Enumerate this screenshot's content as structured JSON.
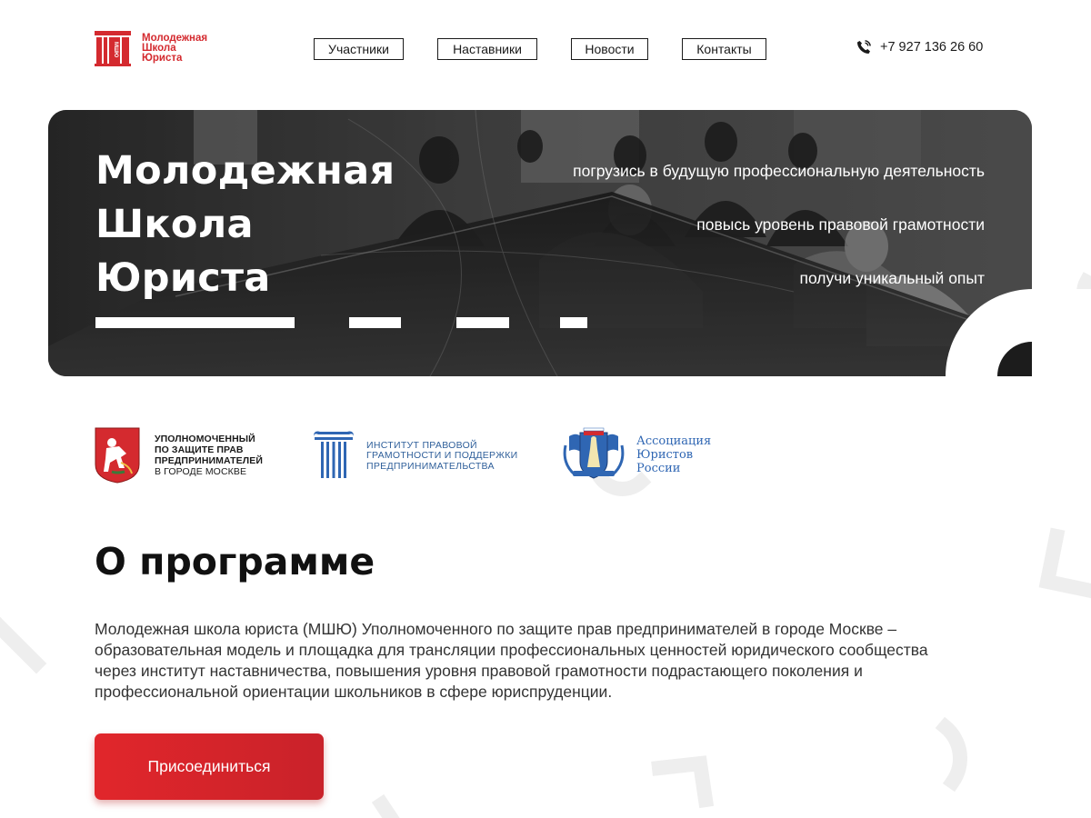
{
  "header": {
    "logo": {
      "line1": "Молодежная",
      "line2": "Школа",
      "line3": "Юриста",
      "mark_text": "МШЮ"
    },
    "nav": [
      {
        "label": "Участники"
      },
      {
        "label": "Наставники"
      },
      {
        "label": "Новости"
      },
      {
        "label": "Контакты"
      }
    ],
    "phone": {
      "icon": "phone-icon",
      "number": "+7 927 136 26 60"
    }
  },
  "hero": {
    "title_lines": [
      "Молодежная",
      "Школа",
      "Юриста"
    ],
    "taglines": [
      "погрузись в будущую профессиональную деятельность",
      "повысь уровень правовой грамотности",
      "получи уникальный опыт"
    ]
  },
  "partners": [
    {
      "name_lines": [
        "УПОЛНОМОЧЕННЫЙ",
        "ПО ЗАЩИТЕ ПРАВ",
        "ПРЕДПРИНИМАТЕЛЕЙ",
        "В ГОРОДЕ МОСКВЕ"
      ],
      "icon": "moscow-coat-of-arms-icon"
    },
    {
      "name_lines": [
        "ИНСТИТУТ ПРАВОВОЙ",
        "ГРАМОТНОСТИ И ПОДДЕРЖКИ",
        "ПРЕДПРИНИМАТЕЛЬСТВА"
      ],
      "icon": "column-icon"
    },
    {
      "name_lines": [
        "Ассоциация",
        "Юристов",
        "России"
      ],
      "icon": "association-emblem-icon"
    }
  ],
  "about": {
    "title": "О программе",
    "text": "Молодежная школа юриста (МШЮ) Уполномоченного по защите прав предпринимателей в городе Москве – образовательная модель и площадка для трансляции профессиональных ценностей юридического сообщества через институт наставничества, повышения уровня правовой грамотности подрастающего поколения и профессиональной ориентации школьников в сфере юриспруденции.",
    "button_label": "Присоединиться"
  },
  "colors": {
    "brand_red": "#d42a2f",
    "button_red": "#e1262b",
    "text_dark": "#1a1a1a",
    "partner_blue": "#2f5f9a"
  }
}
